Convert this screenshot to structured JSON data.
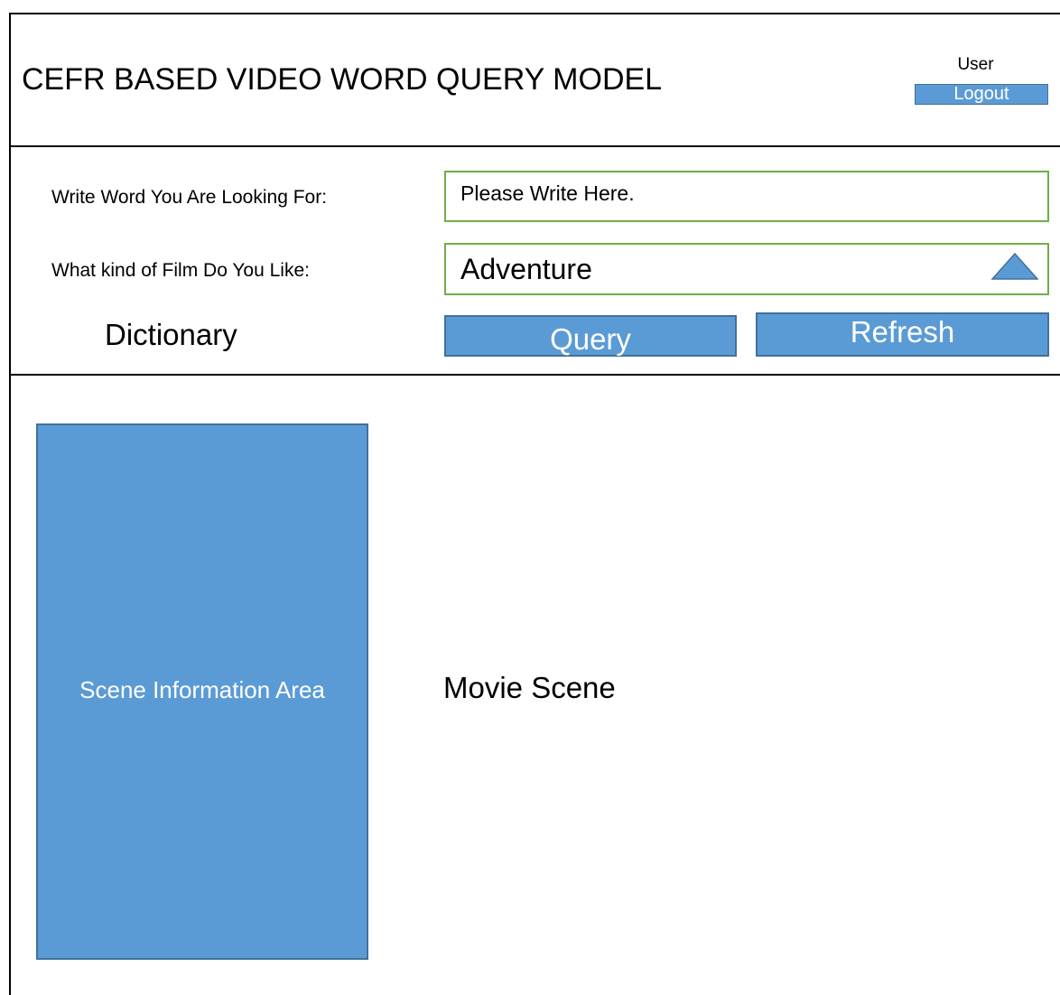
{
  "header": {
    "title": "CEFR BASED VIDEO WORD QUERY MODEL",
    "user_label": "User",
    "logout_label": "Logout"
  },
  "form": {
    "word_label": "Write Word You Are Looking For:",
    "word_placeholder": "Please Write Here.",
    "film_label": "What kind of Film Do You Like:",
    "film_selected": "Adventure",
    "film_dropdown_icon": "triangle-up-icon",
    "dictionary_label": "Dictionary",
    "query_label": "Query",
    "refresh_label": "Refresh"
  },
  "content": {
    "scene_info_label": "Scene Information Area",
    "movie_scene_label": "Movie Scene"
  },
  "colors": {
    "button_fill": "#5b9bd5",
    "button_border": "#41719c",
    "input_border": "#70ad47"
  }
}
